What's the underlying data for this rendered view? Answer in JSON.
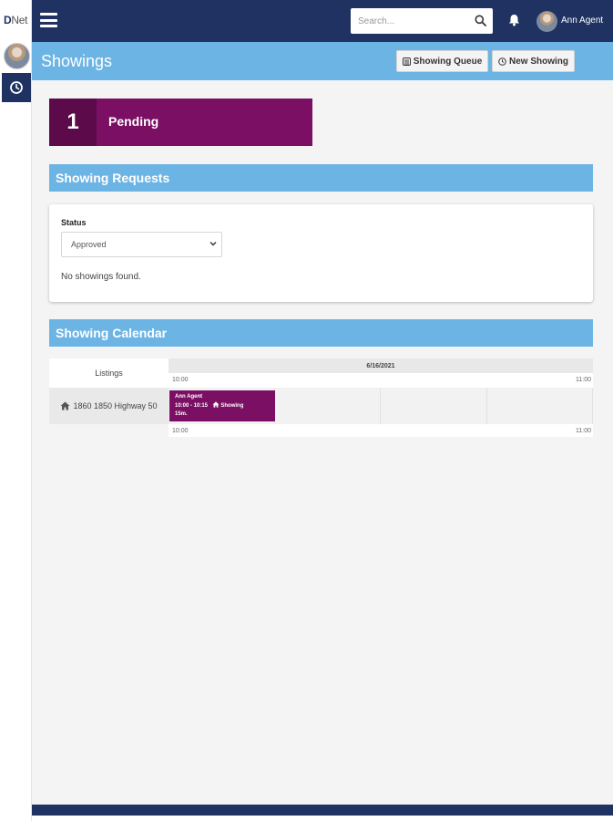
{
  "app": {
    "brand_bold": "D",
    "brand_rest": "Net"
  },
  "topbar": {
    "search_placeholder": "Search...",
    "user_name": "Ann Agent"
  },
  "page": {
    "title": "Showings",
    "buttons": {
      "queue": "Showing Queue",
      "new_showing": "New Showing"
    }
  },
  "pending": {
    "count": "1",
    "label": "Pending"
  },
  "requests": {
    "title": "Showing Requests",
    "status_label": "Status",
    "status_selected": "Approved",
    "empty_message": "No showings found."
  },
  "calendar": {
    "title": "Showing Calendar",
    "listings_header": "Listings",
    "date": "6/16/2021",
    "time_start": "10:00",
    "time_end": "11:00",
    "listing": "1860 1850 Highway 50",
    "event": {
      "agent": "Ann Agent",
      "time": "10:00 - 10:15",
      "type": "Showing",
      "duration": "15m."
    }
  },
  "colors": {
    "navy": "#1f3261",
    "sky": "#6cb4e4",
    "plum": "#7a0f63"
  }
}
